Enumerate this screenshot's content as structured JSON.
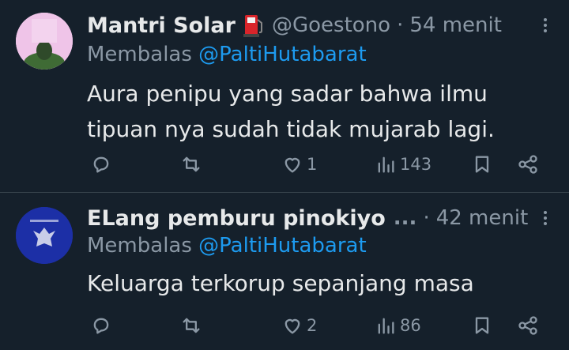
{
  "tweets": [
    {
      "name": "Mantri Solar",
      "badge_icon": "fuel-pump-icon",
      "handle": "@Goestono",
      "separator": "·",
      "time": "54 menit",
      "replying_prefix": "Membalas",
      "replying_to": "@PaltiHutabarat",
      "text": "Aura penipu yang sadar bahwa ilmu tipuan nya sudah tidak mujarab lagi.",
      "stats": {
        "replies": "",
        "retweets": "",
        "likes": "1",
        "views": "143"
      }
    },
    {
      "name": "ELang pemburu pinokiyo",
      "name_ellipsis": "...",
      "separator": "·",
      "time": "42 menit",
      "replying_prefix": "Membalas",
      "replying_to": "@PaltiHutabarat",
      "text": "Keluarga terkorup sepanjang masa",
      "stats": {
        "replies": "",
        "retweets": "",
        "likes": "2",
        "views": "86"
      }
    }
  ],
  "colors": {
    "background": "#15202b",
    "text": "#e7e9ea",
    "muted": "#8b98a5",
    "link": "#1d9bf0",
    "divider": "#38444d"
  }
}
